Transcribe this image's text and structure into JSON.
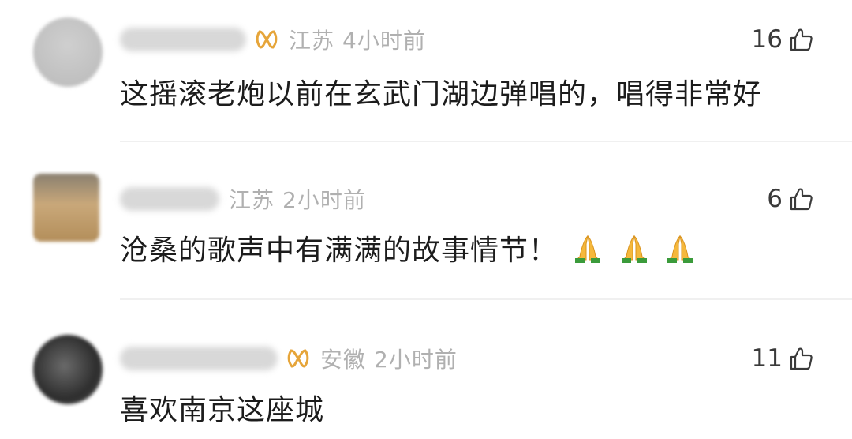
{
  "comments": [
    {
      "location": "江苏",
      "time": "4小时前",
      "likes": "16",
      "text": "这摇滚老炮以前在玄武门湖边弹唱的，唱得非常好",
      "vip": true,
      "emoji_count": 0
    },
    {
      "location": "江苏",
      "time": "2小时前",
      "likes": "6",
      "text": "沧桑的歌声中有满满的故事情节！",
      "vip": false,
      "emoji_count": 3
    },
    {
      "location": "安徽",
      "time": "2小时前",
      "likes": "11",
      "text": "喜欢南京这座城",
      "vip": true,
      "emoji_count": 0
    }
  ],
  "icons": {
    "like": "thumbs-up-icon",
    "vip": "gold-loop-badge-icon",
    "emoji": "folded-hands-emoji"
  },
  "colors": {
    "meta_text": "#b0b0b0",
    "comment_text": "#1c1c1c",
    "vip_gold": "#e6a53a",
    "divider": "#f0f0f0"
  }
}
